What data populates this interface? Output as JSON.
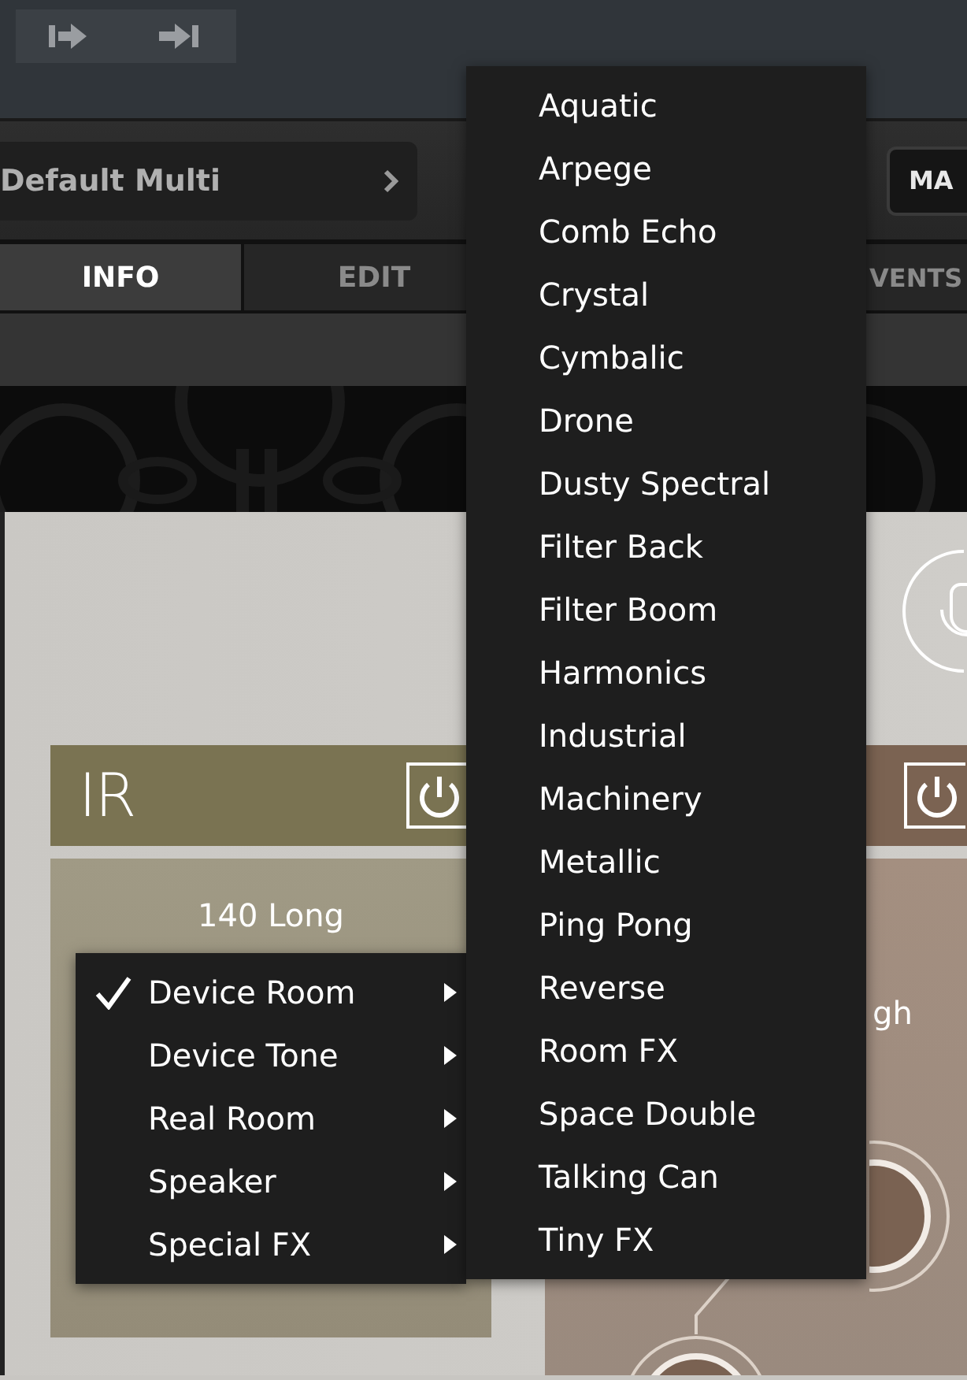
{
  "preset": {
    "name": "Default Multi"
  },
  "header_button": {
    "label": "MA"
  },
  "tabs": [
    {
      "label": "INFO",
      "selected": true
    },
    {
      "label": "EDIT",
      "selected": false
    },
    {
      "label": "VENTS",
      "selected": false
    }
  ],
  "ir_module": {
    "title": "IR",
    "value": "140 Long"
  },
  "right_module": {
    "label_fragment": "gh"
  },
  "category_menu": {
    "items": [
      {
        "label": "Device Room",
        "checked": true,
        "has_submenu": true
      },
      {
        "label": "Device Tone",
        "checked": false,
        "has_submenu": true
      },
      {
        "label": "Real Room",
        "checked": false,
        "has_submenu": true
      },
      {
        "label": "Speaker",
        "checked": false,
        "has_submenu": true
      },
      {
        "label": "Special FX",
        "checked": false,
        "has_submenu": true
      }
    ]
  },
  "submenu": {
    "items": [
      "Aquatic",
      "Arpege",
      "Comb Echo",
      "Crystal",
      "Cymbalic",
      "Drone",
      "Dusty Spectral",
      "Filter Back",
      "Filter Boom",
      "Harmonics",
      "Industrial",
      "Machinery",
      "Metallic",
      "Ping Pong",
      "Reverse",
      "Room FX",
      "Space Double",
      "Talking Can",
      "Tiny FX"
    ]
  }
}
